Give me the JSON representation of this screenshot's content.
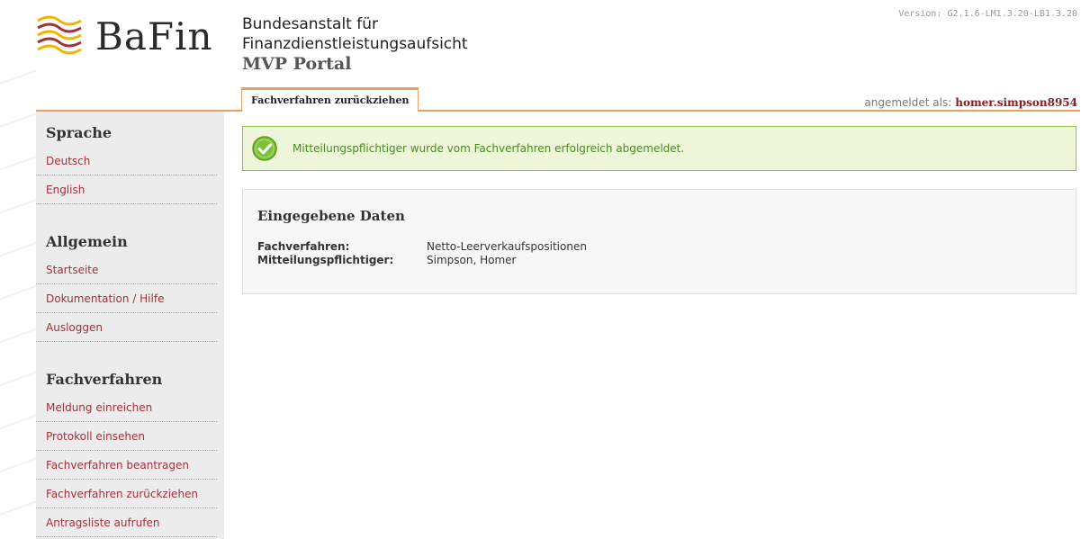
{
  "header": {
    "logo_text": "BaFin",
    "title_line1": "Bundesanstalt für",
    "title_line2": "Finanzdienstleistungsaufsicht",
    "title_line3": "MVP Portal",
    "version": "Version: G2.1.6-LM1.3.20-LB1.3.20"
  },
  "tab": {
    "label": "Fachverfahren zurückziehen"
  },
  "login": {
    "prefix": "angemeldet als:",
    "user": "homer.simpson8954"
  },
  "sidebar": {
    "sections": [
      {
        "title": "Sprache",
        "items": [
          "Deutsch",
          "English"
        ]
      },
      {
        "title": "Allgemein",
        "items": [
          "Startseite",
          "Dokumentation / Hilfe",
          "Ausloggen"
        ]
      },
      {
        "title": "Fachverfahren",
        "items": [
          "Meldung einreichen",
          "Protokoll einsehen",
          "Fachverfahren beantragen",
          "Fachverfahren zurückziehen",
          "Antragsliste aufrufen"
        ]
      }
    ]
  },
  "success": {
    "message": "Mitteilungspflichtiger wurde vom Fachverfahren erfolgreich abgemeldet."
  },
  "data_panel": {
    "title": "Eingegebene Daten",
    "rows": [
      {
        "label": "Fachverfahren:",
        "value": "Netto-Leerverkaufspositionen"
      },
      {
        "label": "Mitteilungspflichtiger:",
        "value": "Simpson, Homer"
      }
    ]
  },
  "colors": {
    "accent": "#e8a06a",
    "link": "#a2313a",
    "success_border": "#8ec24a",
    "success_bg": "#eef6d9"
  },
  "icons": {
    "success": "check-circle-icon",
    "logo": "bafin-wave-logo-icon"
  }
}
